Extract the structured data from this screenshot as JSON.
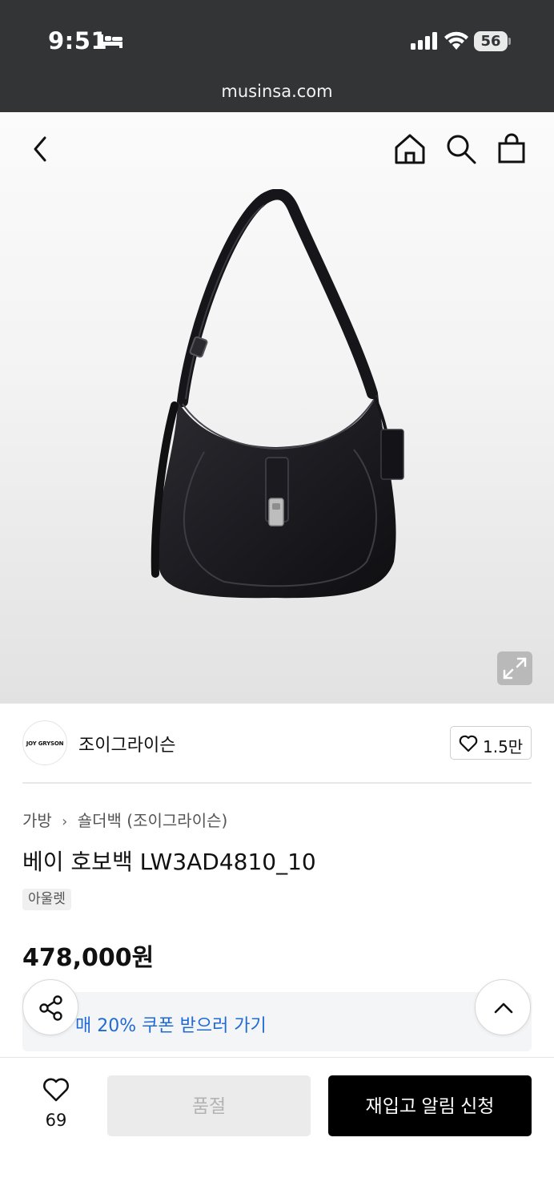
{
  "status_bar": {
    "time": "9:51",
    "battery": "56"
  },
  "browser": {
    "url": "musinsa.com"
  },
  "header": {
    "icons": [
      "back-icon",
      "home-icon",
      "search-icon",
      "shopping-bag-icon"
    ]
  },
  "brand": {
    "logo_text": "JOY GRYSON",
    "name": "조이그라이슨",
    "like_count": "1.5만"
  },
  "breadcrumb": {
    "category": "가방",
    "subcategory": "숄더백 (조이그라이슨)"
  },
  "product": {
    "title": "베이 호보백 LW3AD4810_10",
    "tag": "아울렛",
    "price": "478,000원"
  },
  "coupon": {
    "text": "매 20% 쿠폰 받으러 가기"
  },
  "bottom_bar": {
    "wish_count": "69",
    "soldout_label": "품절",
    "restock_label": "재입고 알림 신청"
  },
  "colors": {
    "status_bg": "#323436",
    "coupon_link": "#1f6ad6",
    "primary_button": "#000000",
    "disabled_button": "#ebebeb"
  }
}
